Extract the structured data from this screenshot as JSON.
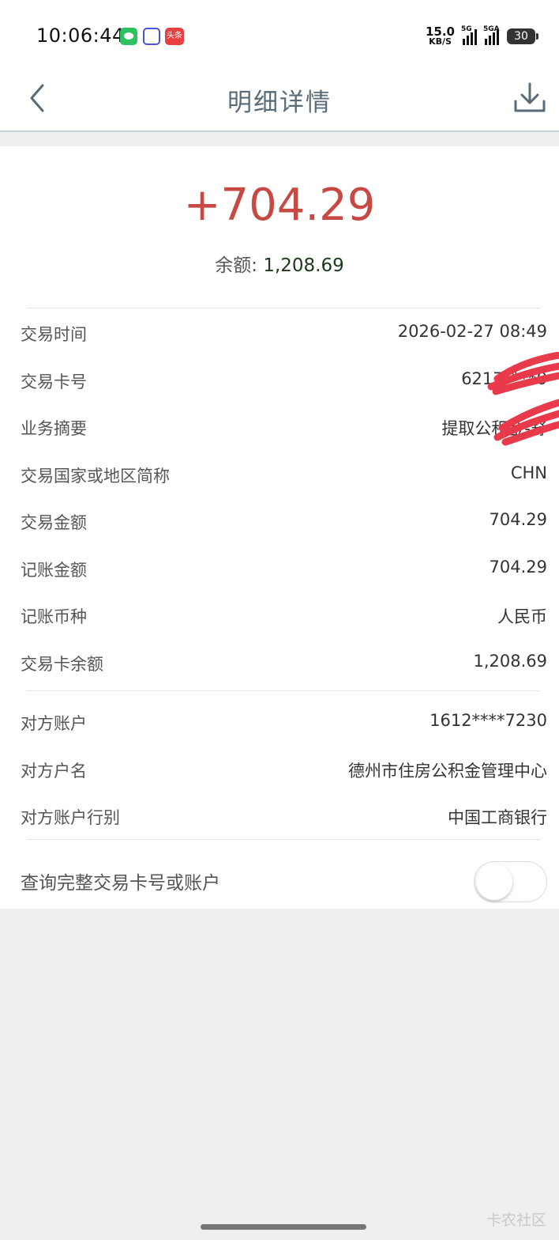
{
  "status_bar": {
    "time": "10:06:44",
    "speed_value": "15.0",
    "speed_unit": "KB/S",
    "signal1_label": "5G",
    "signal2_label": "5GA",
    "battery": "30",
    "app3_label": "头条"
  },
  "nav": {
    "title": "明细详情",
    "back_icon": "chevron-left-icon",
    "download_icon": "download-icon"
  },
  "summary": {
    "amount": "+704.29",
    "balance_label": "余额: ",
    "balance_value": "1,208.69"
  },
  "details": [
    {
      "label": "交易时间",
      "value": "2026-02-27 08:49"
    },
    {
      "label": "交易卡号",
      "value": "6217****0"
    },
    {
      "label": "业务摘要",
      "value": "提取公积金-舒"
    },
    {
      "label": "交易国家或地区简称",
      "value": "CHN"
    },
    {
      "label": "交易金额",
      "value": "704.29"
    },
    {
      "label": "记账金额",
      "value": "704.29"
    },
    {
      "label": "记账币种",
      "value": "人民币"
    },
    {
      "label": "交易卡余额",
      "value": "1,208.69"
    }
  ],
  "counterparty": [
    {
      "label": "对方账户",
      "value": "1612****7230"
    },
    {
      "label": "对方户名",
      "value": "德州市住房公积金管理中心"
    },
    {
      "label": "对方账户行别",
      "value": "中国工商银行"
    }
  ],
  "toggle": {
    "label": "查询完整交易卡号或账户",
    "enabled": false
  },
  "watermark": "卡农社区",
  "colors": {
    "amount_red": "#c64a43",
    "nav_title": "#5a6b78",
    "redaction": "#e83a4a"
  }
}
